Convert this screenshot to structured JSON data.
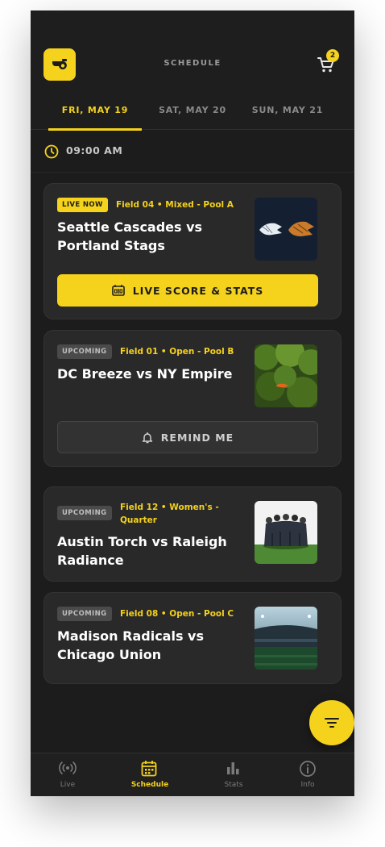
{
  "header": {
    "title": "SCHEDULE",
    "logo_icon": "whistle-icon",
    "cart_icon": "cart-icon",
    "cart_count": "2"
  },
  "tabs": [
    {
      "label": "FRI, MAY 19",
      "active": true
    },
    {
      "label": "SAT, MAY 20",
      "active": false
    },
    {
      "label": "SUN, MAY 21",
      "active": false
    }
  ],
  "time_slot": {
    "icon": "clock-icon",
    "label": "09:00 AM"
  },
  "games": [
    {
      "status": "LIVE NOW",
      "meta": "Field 04 • Mixed - Pool A",
      "title_line1": "Seattle Cascades vs",
      "title_line2": "Portland Stags",
      "image": "team-logos-image",
      "action_label": "LIVE SCORE & STATS",
      "action_icon": "scoreboard-icon"
    },
    {
      "status": "UPCOMING",
      "meta": "Field 01 • Open - Pool B",
      "title_line1": "DC Breeze vs NY Empire",
      "image": "frisbee-in-trees-image",
      "action_label": "REMIND ME",
      "action_icon": "bell-icon"
    },
    {
      "status": "UPCOMING",
      "meta_line1": "Field 12 • Women's -",
      "meta_line2": "Quarter",
      "title_line1": "Austin Torch vs Raleigh",
      "title_line2": "Radiance",
      "image": "team-huddle-image"
    },
    {
      "status": "UPCOMING",
      "meta": "Field 08 • Open - Pool C",
      "title_line1": "Madison Radicals vs",
      "title_line2": "Chicago Union",
      "image": "stadium-image"
    }
  ],
  "fab": {
    "icon": "filter-icon"
  },
  "bottom_nav": [
    {
      "label": "Live",
      "icon": "broadcast-icon",
      "active": false
    },
    {
      "label": "Schedule",
      "icon": "calendar-icon",
      "active": true
    },
    {
      "label": "Stats",
      "icon": "bar-chart-icon",
      "active": false
    },
    {
      "label": "Info",
      "icon": "info-icon",
      "active": false
    }
  ],
  "colors": {
    "accent": "#f5d21c",
    "background": "#1c1c1c",
    "card": "#292929"
  }
}
